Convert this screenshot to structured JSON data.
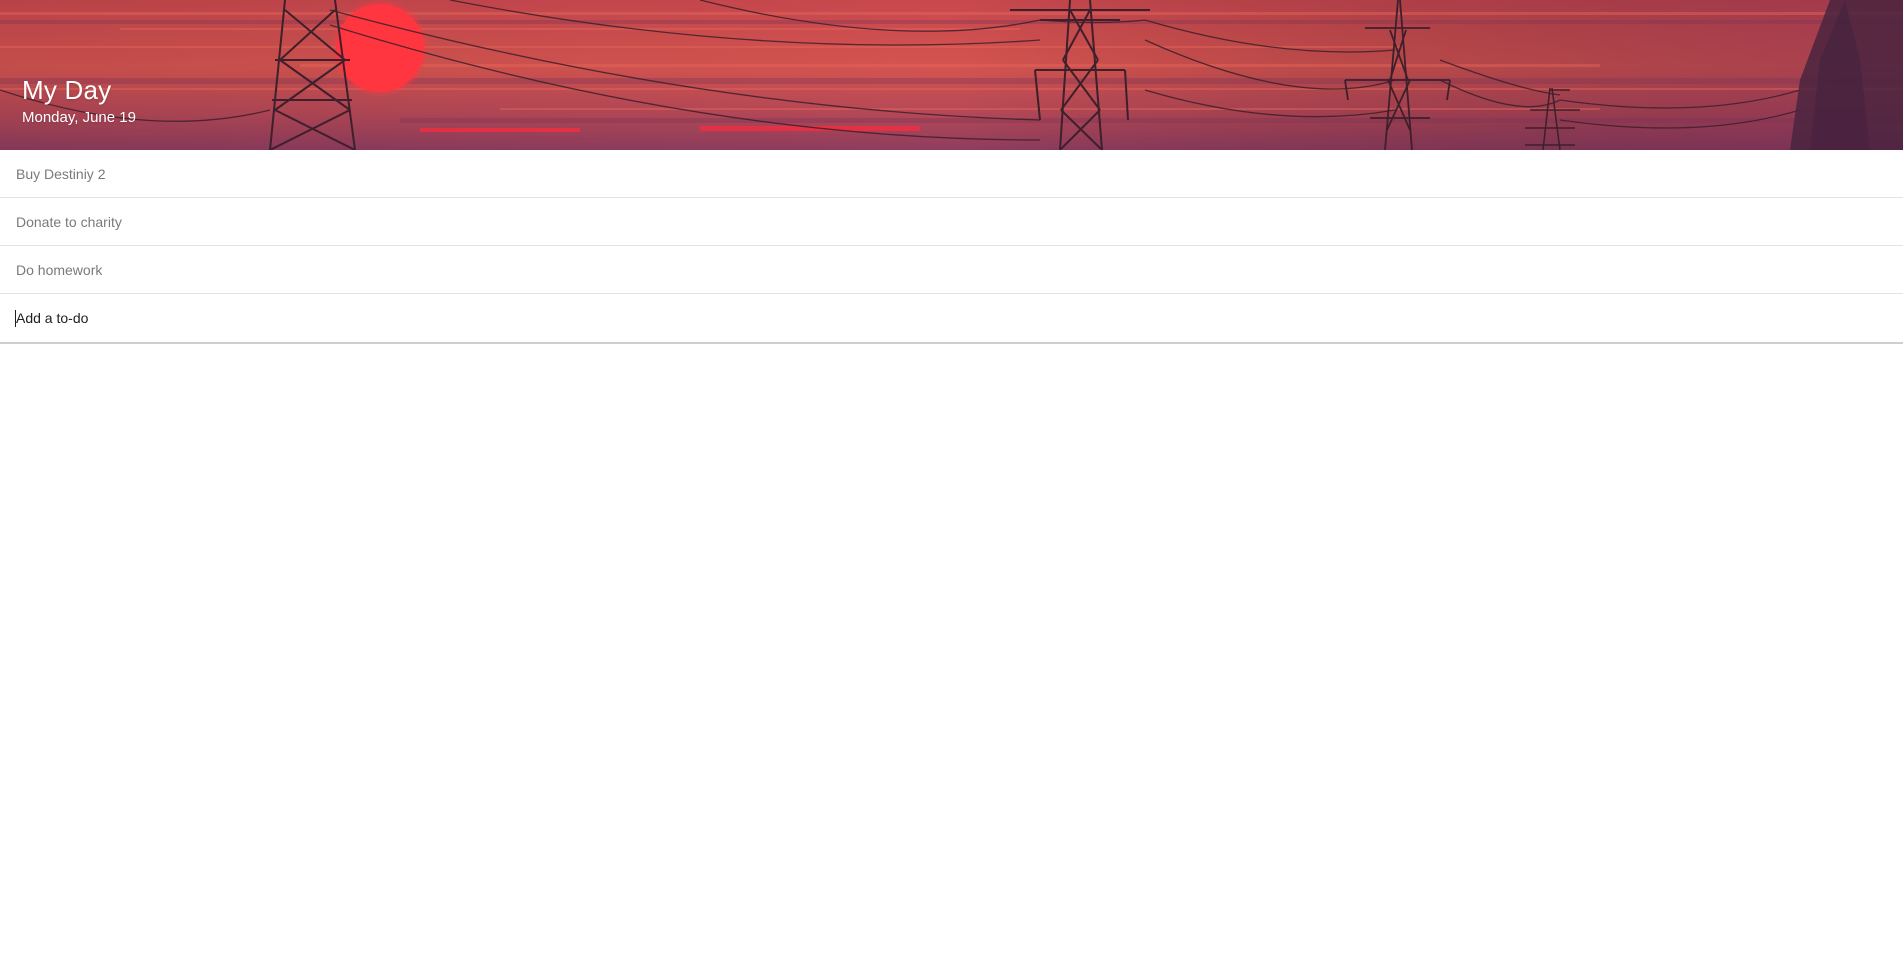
{
  "header": {
    "title": "My Day",
    "date": "Monday, June 19",
    "background_colors": {
      "sky_top": "#c8484e",
      "sky_mid": "#d9504c",
      "sky_bottom": "#9a3f5e",
      "sun": "#ff3540",
      "silhouette": "#3e1f2c"
    }
  },
  "todos": [
    {
      "label": "Buy Destiniy 2"
    },
    {
      "label": "Donate to charity"
    },
    {
      "label": "Do homework"
    }
  ],
  "add_todo": {
    "placeholder": "Add a to-do",
    "value": ""
  }
}
